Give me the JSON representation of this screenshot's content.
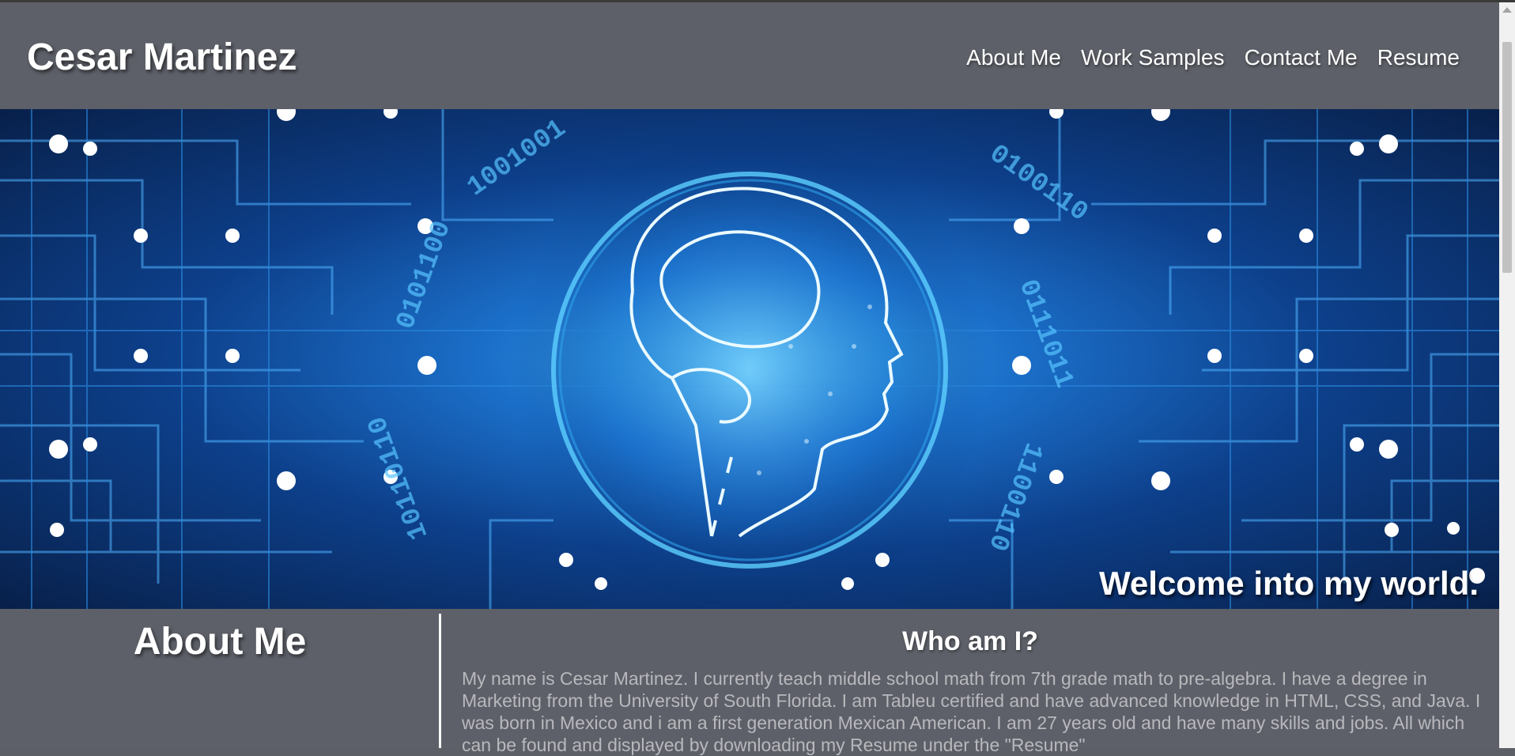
{
  "header": {
    "site_title": "Cesar Martinez",
    "nav": [
      {
        "label": "About Me"
      },
      {
        "label": "Work Samples"
      },
      {
        "label": "Contact Me"
      },
      {
        "label": "Resume"
      }
    ]
  },
  "hero": {
    "image_name": "brain-circuit-banner",
    "caption": "Welcome into my world."
  },
  "about": {
    "title": "About Me"
  },
  "who": {
    "title": "Who am I?",
    "text": "My name is Cesar Martinez. I currently teach middle school math from 7th grade math to pre-algebra. I have a degree in Marketing from the University of South Florida. I am Tableu certified and have advanced knowledge in HTML, CSS, and Java. I was born in Mexico and i am a first generation Mexican American. I am 27 years old and have many skills and jobs. All which can be found and displayed by downloading my Resume under the \"Resume\""
  },
  "colors": {
    "header_bg": "#5d6068",
    "page_bg": "#5c5f66",
    "text_white": "#ffffff",
    "body_text": "#b8b8bd",
    "hero_blue": "#1b6fc9"
  }
}
